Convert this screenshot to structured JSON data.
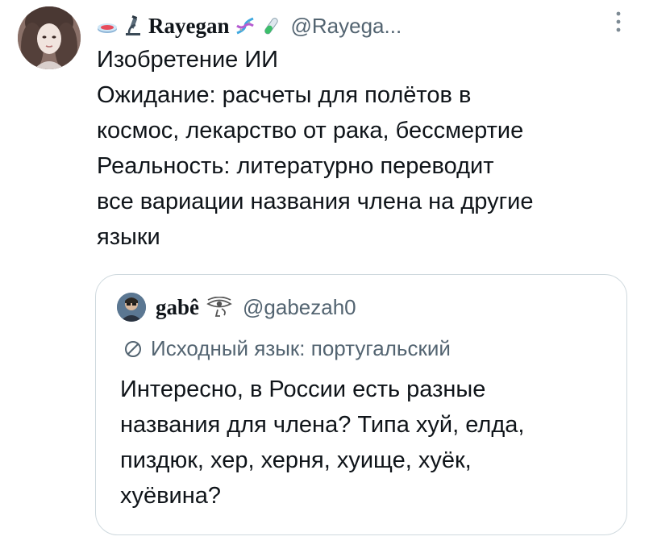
{
  "tweet": {
    "author": {
      "display_name": "Rayegan",
      "handle": "@Rayega...",
      "emojis_before": [
        "petri-dish-emoji",
        "microscope-emoji"
      ],
      "emojis_after": [
        "dna-emoji",
        "test-tube-emoji"
      ]
    },
    "body_lines": [
      "Изобретение ИИ",
      "Ожидание: расчеты для полётов в",
      "космос, лекарство от рака, бессмертие",
      "Реальность: литературно переводит",
      "все вариации названия члена на другие",
      "языки"
    ],
    "more_icon": "more-vertical-icon"
  },
  "quote": {
    "author": {
      "display_name": "gabê",
      "handle": "@gabezah0",
      "emoji": "eye-of-horus-emoji"
    },
    "translation_note": "Исходный язык: португальский",
    "translation_icon": "globe-icon",
    "body_lines": [
      "Интересно, в России есть разные",
      "названия для члена? Типа хуй, елда,",
      "пиздюк, хер, херня, хуище, хуёк,",
      "хуёвина?"
    ]
  },
  "colors": {
    "text": "#0f1419",
    "secondary": "#536471",
    "border": "#cfd9de",
    "background": "#ffffff"
  }
}
